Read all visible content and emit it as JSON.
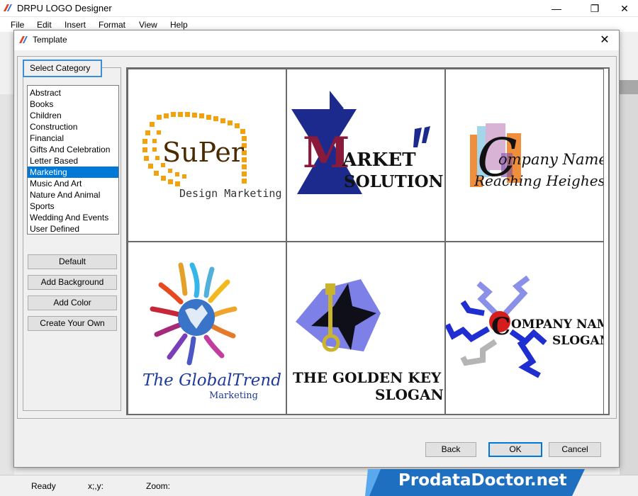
{
  "app": {
    "title": "DRPU LOGO Designer",
    "window_controls": {
      "minimize": "—",
      "maximize": "❐",
      "close": "✕"
    }
  },
  "menu": [
    "File",
    "Edit",
    "Insert",
    "Format",
    "View",
    "Help"
  ],
  "dialog": {
    "title": "Template",
    "close": "✕",
    "category_label": "Select Category",
    "categories": [
      "Abstract",
      "Books",
      "Children",
      "Construction",
      "Financial",
      "Gifts And Celebration",
      "Letter Based",
      "Marketing",
      "Music And Art",
      "Nature And Animal",
      "Sports",
      "Wedding And Events",
      "User Defined"
    ],
    "selected_category": "Marketing",
    "buttons": {
      "default": "Default",
      "add_background": "Add Background",
      "add_color": "Add Color",
      "create_own": "Create Your Own"
    },
    "templates": [
      {
        "line1": "SuPer",
        "line2": "Design Marketing"
      },
      {
        "line1": "ARKET",
        "line2": "SOLUTION",
        "mark": "M"
      },
      {
        "line1": "ompany Name",
        "line2": "Reaching Heighest",
        "mark": "C"
      },
      {
        "line1": "The GlobalTrend",
        "line2": "Marketing"
      },
      {
        "line1": "THE GOLDEN KEY",
        "line2": "SLOGAN"
      },
      {
        "line1": "OMPANY NAME",
        "line2": "SLOGAN"
      }
    ],
    "footer": {
      "back": "Back",
      "ok": "OK",
      "cancel": "Cancel"
    }
  },
  "status": {
    "state": "Ready",
    "coords": "x;,y:",
    "zoom": "Zoom:"
  },
  "banner": "ProdataDoctor.net",
  "colors": {
    "accent": "#0078d7",
    "banner": "#1f6fc0"
  }
}
